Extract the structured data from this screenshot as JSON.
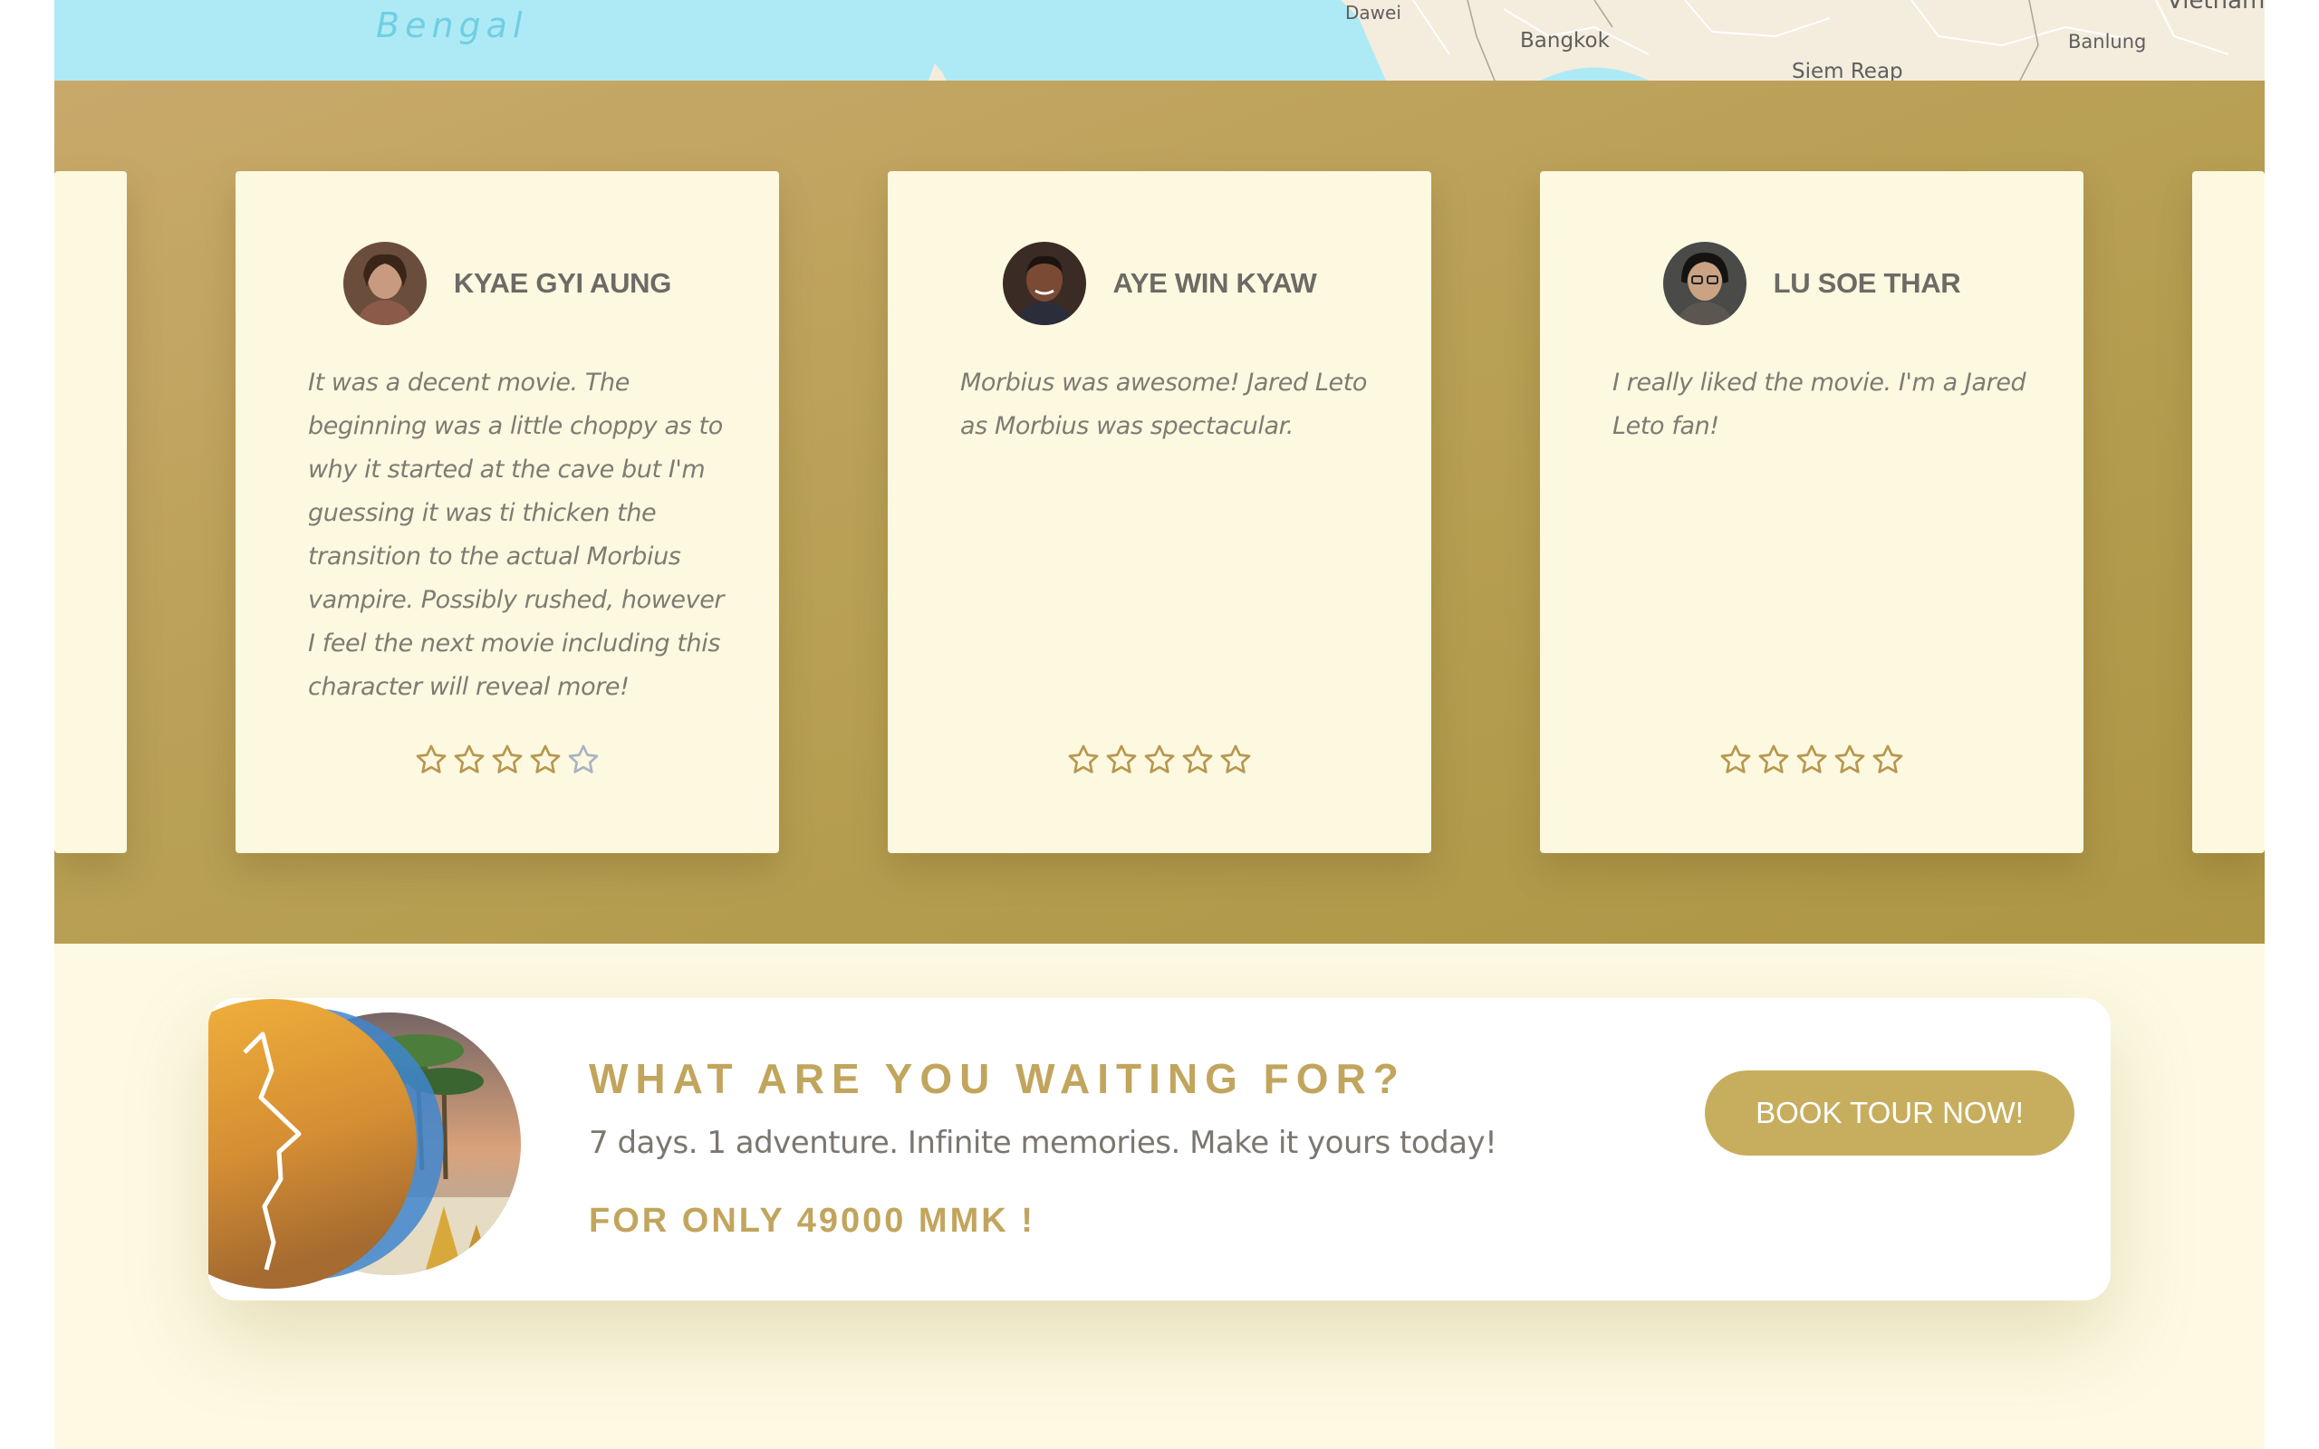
{
  "map": {
    "labels": {
      "sea": "Bengal",
      "dawei": "Dawei",
      "bangkok": "Bangkok",
      "siem_reap": "Siem Reap",
      "banlung": "Banlung",
      "vietnam": "Vietnam"
    }
  },
  "testimonials": [
    {
      "name": "KYAE GYI AUNG",
      "text": "It was a decent movie. The beginning was a little choppy as to why it started at the cave but I'm guessing it was ti thicken the transition to the actual Morbius vampire. Possibly rushed, however I feel the next movie including this character will reveal more!",
      "rating": 4,
      "max_rating": 5
    },
    {
      "name": "AYE WIN KYAW",
      "text": "Morbius was awesome! Jared Leto as Morbius was spectacular.",
      "rating": 5,
      "max_rating": 5
    },
    {
      "name": "LU SOE THAR",
      "text": "I really liked the movie. I'm a Jared Leto fan!",
      "rating": 5,
      "max_rating": 5
    }
  ],
  "cta": {
    "title": "WHAT ARE YOU WAITING FOR?",
    "subtitle": "7 days. 1 adventure. Infinite memories. Make it yours today!",
    "price": "FOR ONLY 49000 MMK !",
    "button_label": "BOOK TOUR NOW!"
  },
  "colors": {
    "accent": "#c2a55d",
    "band": "#b9a055",
    "card": "#fdf9e0",
    "star_filled": "#b8974f",
    "star_empty": "#a9b4c2"
  }
}
